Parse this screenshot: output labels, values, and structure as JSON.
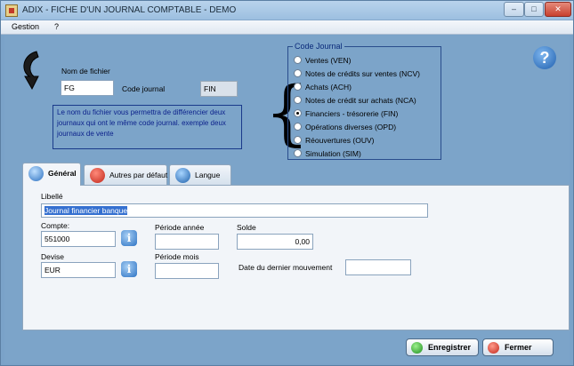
{
  "window": {
    "title": "ADIX - FICHE D'UN JOURNAL COMPTABLE - DEMO",
    "controls": {
      "minimize": "–",
      "maximize": "□",
      "close": "✕"
    }
  },
  "menu": {
    "gestion": "Gestion",
    "help": "?"
  },
  "header": {
    "nom_fichier_label": "Nom de fichier",
    "nom_fichier_value": "FG",
    "code_journal_label": "Code journal",
    "code_journal_value": "FIN",
    "info_text": "Le nom du fichier vous permettra de différencier deux journaux qui ont le même code journal. exemple deux journaux de vente",
    "help_icon_text": "?"
  },
  "code_journal_group": {
    "legend": "Code Journal",
    "options": [
      {
        "label": "Ventes (VEN)",
        "selected": false
      },
      {
        "label": "Notes de crédits sur ventes (NCV)",
        "selected": false
      },
      {
        "label": "Achats (ACH)",
        "selected": false
      },
      {
        "label": "Notes de crédit sur achats (NCA)",
        "selected": false
      },
      {
        "label": "Financiers - trésorerie (FIN)",
        "selected": true
      },
      {
        "label": "Opérations diverses (OPD)",
        "selected": false
      },
      {
        "label": "Réouvertures (OUV)",
        "selected": false
      },
      {
        "label": "Simulation (SIM)",
        "selected": false
      }
    ]
  },
  "tabs": [
    {
      "label": "Général",
      "icon": "info-icon",
      "active": true
    },
    {
      "label": "Autres par défaut",
      "icon": "close-circle-icon",
      "active": false
    },
    {
      "label": "Langue",
      "icon": "globe-icon",
      "active": false
    }
  ],
  "general": {
    "libelle_label": "Libellé",
    "libelle_value": "Journal financier banque",
    "compte_label": "Compte:",
    "compte_value": "551000",
    "periode_annee_label": "Période année",
    "periode_annee_value": "",
    "solde_label": "Solde",
    "solde_value": "0,00",
    "devise_label": "Devise",
    "devise_value": "EUR",
    "periode_mois_label": "Période mois",
    "periode_mois_value": "",
    "dernier_mouvement_label": "Date du dernier mouvement",
    "dernier_mouvement_value": "",
    "info_button_text": "i"
  },
  "actions": {
    "save_label": "Enregistrer",
    "close_label": "Fermer"
  },
  "colors": {
    "window_bg": "#7ca4c9",
    "panel_bg": "#f2f5f9",
    "info_text": "#0a1f8a",
    "legend_text": "#0a2a7a"
  }
}
